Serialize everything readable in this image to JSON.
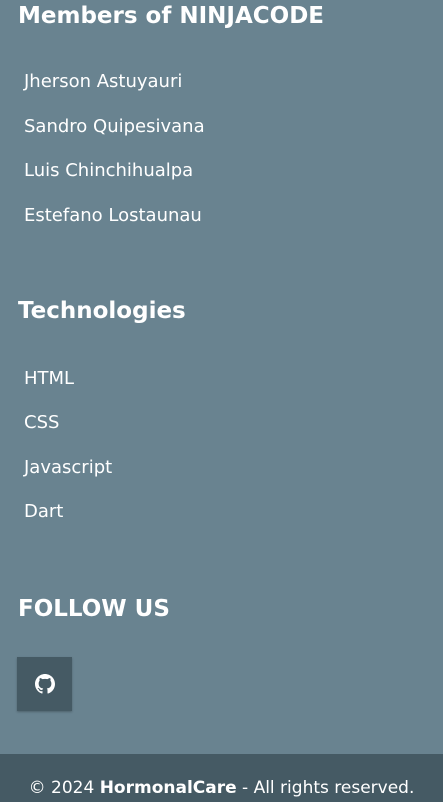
{
  "members": {
    "title": "Members of NINJACODE",
    "items": [
      "Jherson Astuyauri",
      "Sandro Quipesivana",
      "Luis Chinchihualpa",
      "Estefano Lostaunau"
    ]
  },
  "technologies": {
    "title": "Technologies",
    "items": [
      "HTML",
      "CSS",
      "Javascript",
      "Dart"
    ]
  },
  "follow": {
    "title": "FOLLOW US",
    "social_icon": "github-icon"
  },
  "copyright": {
    "prefix": "© 2024 ",
    "brand": "HormonalCare",
    "suffix": " - All rights reserved."
  },
  "colors": {
    "background": "#698390",
    "dark": "#455a64",
    "text": "#ffffff"
  }
}
